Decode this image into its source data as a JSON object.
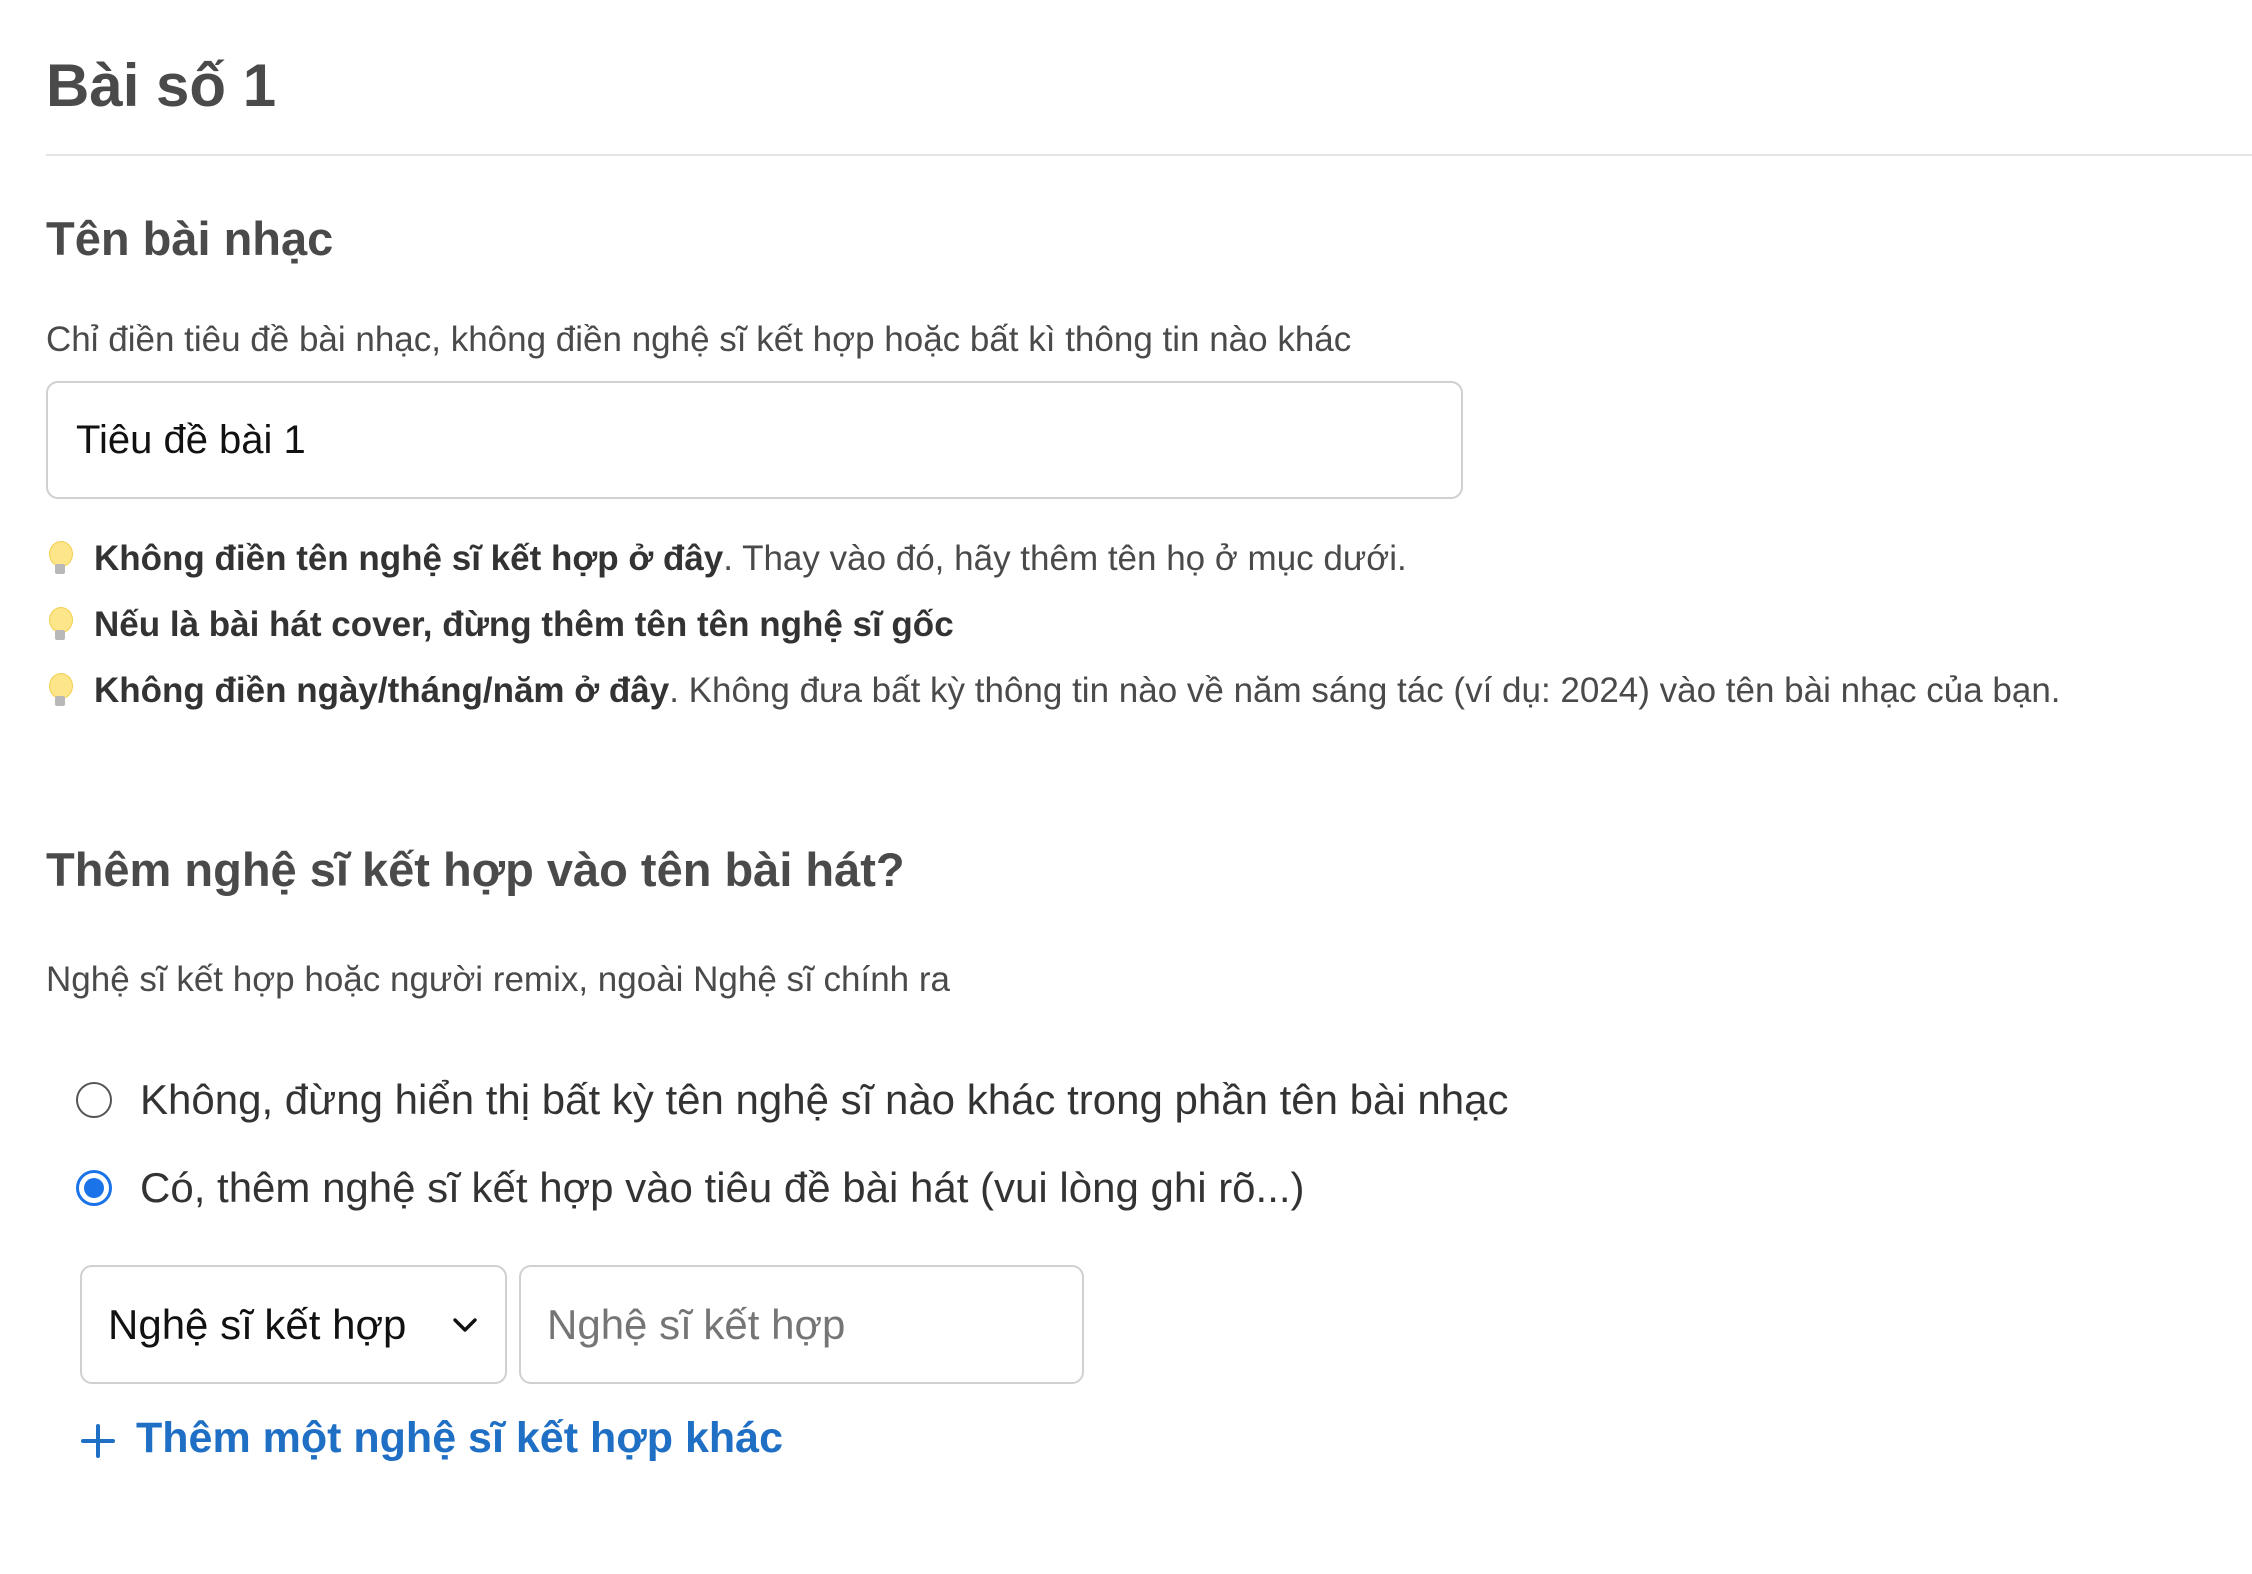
{
  "page": {
    "title": "Bài số 1"
  },
  "song_title_section": {
    "heading": "Tên bài nhạc",
    "description": "Chỉ điền tiêu đề bài nhạc, không điền nghệ sĩ kết hợp hoặc bất kì thông tin nào khác",
    "input_value": "Tiêu đề bài 1",
    "tips": [
      {
        "icon": "lightbulb-icon",
        "bold": "Không điền tên nghệ sĩ kết hợp ở đây",
        "rest": ". Thay vào đó, hãy thêm tên họ ở mục dưới."
      },
      {
        "icon": "lightbulb-icon",
        "bold": "Nếu là bài hát cover, đừng thêm tên tên nghệ sĩ gốc",
        "rest": ""
      },
      {
        "icon": "lightbulb-icon",
        "bold": "Không điền ngày/tháng/năm ở đây",
        "rest": ". Không đưa bất kỳ thông tin nào về năm sáng tác (ví dụ: 2024) vào tên bài nhạc của bạn."
      }
    ]
  },
  "featured_section": {
    "heading": "Thêm nghệ sĩ kết hợp vào tên bài hát?",
    "description": "Nghệ sĩ kết hợp hoặc người remix, ngoài Nghệ sĩ chính ra",
    "options": [
      {
        "label": "Không, đừng hiển thị bất kỳ tên nghệ sĩ nào khác trong phần tên bài nhạc",
        "checked": false
      },
      {
        "label": "Có, thêm nghệ sĩ kết hợp vào tiêu đề bài hát (vui lòng ghi rõ...)",
        "checked": true
      }
    ],
    "role_select_value": "Nghệ sĩ kết hợp",
    "artist_input_placeholder": "Nghệ sĩ kết hợp",
    "add_link_label": "Thêm một nghệ sĩ kết hợp khác"
  },
  "colors": {
    "accent": "#1a73e8",
    "link": "#1f6fc5",
    "text": "#4a4a4a",
    "border": "#d0d0d0"
  }
}
